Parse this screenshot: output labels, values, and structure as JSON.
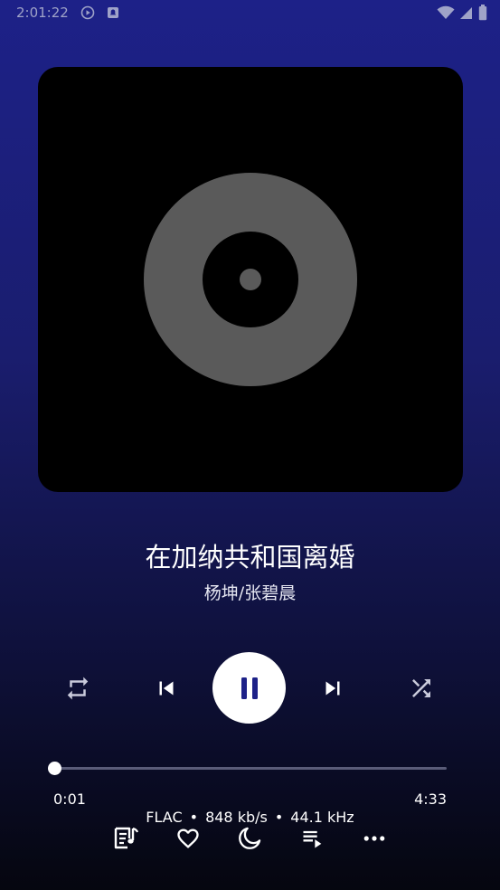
{
  "status_bar": {
    "time": "2:01:22",
    "icons": [
      "play-circle-icon",
      "notification-icon",
      "wifi-icon",
      "signal-icon",
      "battery-icon"
    ]
  },
  "album_art": {
    "placeholder_icon": "vinyl-disc-icon"
  },
  "track": {
    "title": "在加纳共和国离婚",
    "artist": "杨坤/张碧晨"
  },
  "controls": {
    "repeat_icon": "repeat-icon",
    "prev_icon": "skip-previous-icon",
    "play_pause_icon": "pause-icon",
    "next_icon": "skip-next-icon",
    "shuffle_icon": "shuffle-icon"
  },
  "progress": {
    "current": "0:01",
    "total": "4:33",
    "fraction": 0.004
  },
  "audio_info": {
    "format": "FLAC",
    "bitrate": "848 kb/s",
    "sample_rate": "44.1 kHz",
    "separator": "•"
  },
  "bottom_bar": {
    "icons": [
      "lyrics-icon",
      "heart-icon",
      "sleep-timer-icon",
      "queue-icon",
      "more-icon"
    ]
  },
  "colors": {
    "accent": "#1d2188",
    "play_icon": "#1d2188",
    "track_bg": "#5a5c78"
  }
}
